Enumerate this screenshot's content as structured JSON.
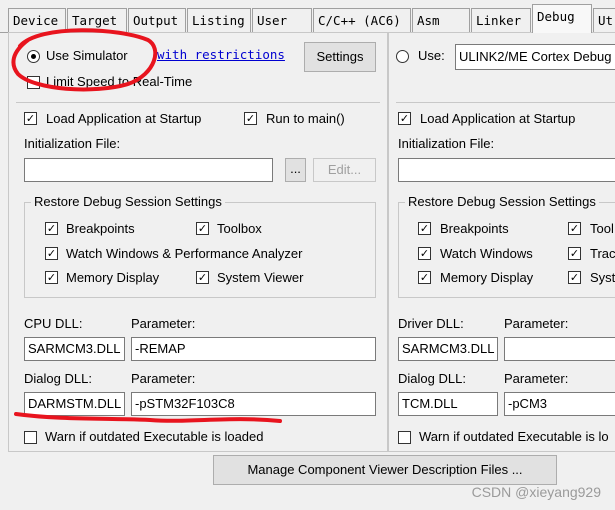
{
  "tabs": [
    {
      "label": "Device"
    },
    {
      "label": "Target"
    },
    {
      "label": "Output"
    },
    {
      "label": "Listing"
    },
    {
      "label": "User"
    },
    {
      "label": "C/C++ (AC6)"
    },
    {
      "label": "Asm"
    },
    {
      "label": "Linker"
    },
    {
      "label": "Debug"
    },
    {
      "label": "Ut"
    }
  ],
  "left": {
    "use_simulator": "Use Simulator",
    "with_restrictions": "with restrictions",
    "settings_button": "Settings",
    "limit_speed": "Limit Speed to Real-Time",
    "load_app": "Load Application at Startup",
    "run_to_main": "Run to main()",
    "init_file_label": "Initialization File:",
    "browse_button": "...",
    "edit_button": "Edit...",
    "restore_group": "Restore Debug Session Settings",
    "breakpoints": "Breakpoints",
    "toolbox": "Toolbox",
    "watch_windows": "Watch Windows & Performance Analyzer",
    "memory_display": "Memory Display",
    "system_viewer": "System Viewer",
    "cpu_dll_label": "CPU DLL:",
    "cpu_param_label": "Parameter:",
    "cpu_dll_value": "SARMCM3.DLL",
    "cpu_param_value": "-REMAP",
    "dialog_dll_label": "Dialog DLL:",
    "dialog_param_label": "Parameter:",
    "dialog_dll_value": "DARMSTM.DLL",
    "dialog_param_value": "-pSTM32F103C8",
    "warn_outdated": "Warn if outdated Executable is loaded"
  },
  "right": {
    "use_label": "Use:",
    "debugger_value": "ULINK2/ME Cortex Debug",
    "load_app": "Load Application at Startup",
    "init_file_label": "Initialization File:",
    "restore_group": "Restore Debug Session Settings",
    "breakpoints": "Breakpoints",
    "toolbox": "Tool",
    "watch_windows": "Watch Windows",
    "trace": "Trac",
    "memory_display": "Memory Display",
    "system": "Syste",
    "driver_dll_label": "Driver DLL:",
    "driver_param_label": "Parameter:",
    "driver_dll_value": "SARMCM3.DLL",
    "driver_param_value": "",
    "dialog_dll_label": "Dialog DLL:",
    "dialog_param_label": "Parameter:",
    "dialog_dll_value": "TCM.DLL",
    "dialog_param_value": "-pCM3",
    "warn_outdated": "Warn if outdated Executable is lo"
  },
  "manage_button": "Manage Component Viewer Description Files ...",
  "watermark": "CSDN @xieyang929",
  "colors": {
    "annotation": "#e8141e",
    "link": "#0000d0"
  }
}
